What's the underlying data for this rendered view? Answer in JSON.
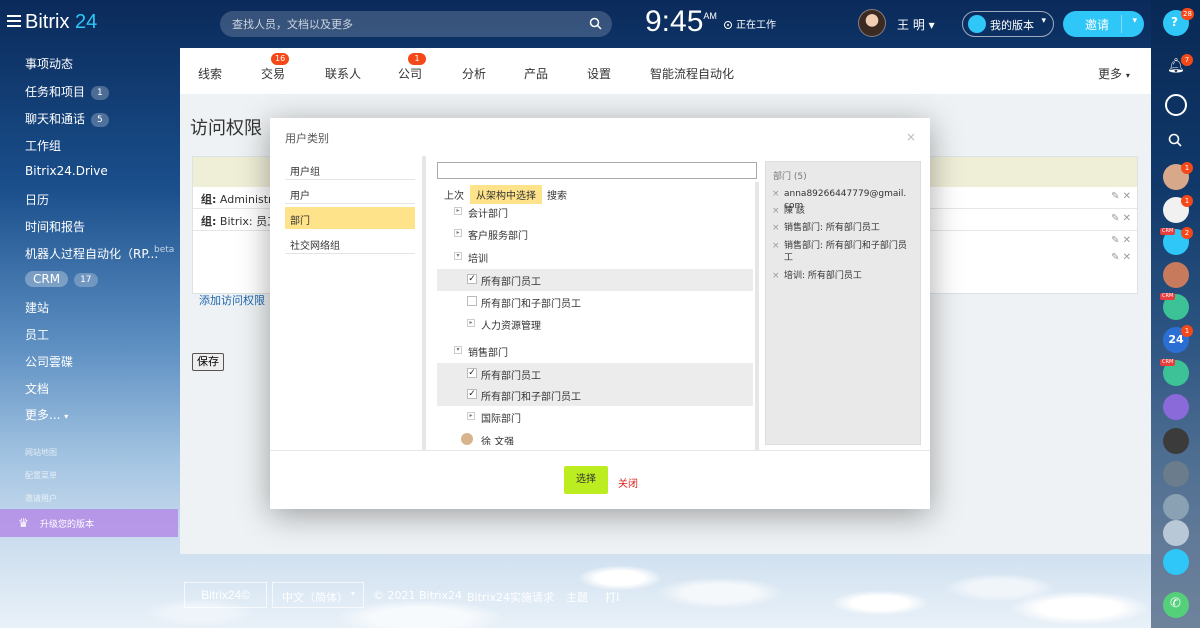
{
  "app": {
    "logo_text": "Bitrix",
    "logo_num": "24"
  },
  "search": {
    "placeholder": "查找人员，文档以及更多"
  },
  "clock": {
    "time": "9:45",
    "ampm": "AM"
  },
  "status": {
    "label": "正在工作"
  },
  "user": {
    "name": "王 明"
  },
  "plan_button": {
    "label": "我的版本"
  },
  "invite_button": {
    "label": "邀请"
  },
  "left_menu": {
    "items": [
      {
        "label": "事项动态"
      },
      {
        "label": "任务和项目",
        "count": "1"
      },
      {
        "label": "聊天和通话",
        "count": "5"
      },
      {
        "label": "工作组"
      },
      {
        "label": "Bitrix24.Drive"
      },
      {
        "label": "日历"
      },
      {
        "label": "时间和报告"
      },
      {
        "label": "机器人过程自动化（RP..."
      },
      {
        "label": "CRM",
        "count": "17"
      },
      {
        "label": "建站"
      },
      {
        "label": "员工"
      },
      {
        "label": "公司雲碟"
      },
      {
        "label": "文档"
      },
      {
        "label": "更多..."
      }
    ],
    "beta": "beta",
    "small_links": [
      "网站地图",
      "配置菜单",
      "邀请用户"
    ],
    "upgrade_label": "升级您的版本"
  },
  "tabs": [
    {
      "label": "线索"
    },
    {
      "label": "交易",
      "badge": "16"
    },
    {
      "label": "联系人"
    },
    {
      "label": "公司",
      "badge": "1"
    },
    {
      "label": "分析"
    },
    {
      "label": "产品"
    },
    {
      "label": "设置"
    },
    {
      "label": "智能流程自动化"
    }
  ],
  "more_tab": "更多",
  "page": {
    "title": "访问权限",
    "rows": [
      {
        "text_bold": "组:",
        "text": " Administrat"
      },
      {
        "text_bold": "组:",
        "text": " Bitrix: 员工"
      }
    ],
    "add_link": "添加访问权限",
    "save_label": "保存"
  },
  "dialog": {
    "title": "用户类别",
    "categories": [
      {
        "label": "用户组"
      },
      {
        "label": "用户"
      },
      {
        "label": "部门",
        "active": true
      },
      {
        "label": "社交网络组"
      }
    ],
    "mid_tabs": [
      "上次",
      "从架构中选择",
      "搜索"
    ],
    "tree": [
      {
        "label": "会计部门",
        "type": "folder",
        "expanded": false
      },
      {
        "label": "客户服务部门",
        "type": "folder",
        "expanded": false
      },
      {
        "label": "培训",
        "type": "folder",
        "expanded": true
      },
      {
        "label": "所有部门员工",
        "type": "check",
        "checked": true
      },
      {
        "label": "所有部门和子部门员工",
        "type": "check",
        "checked": false
      },
      {
        "label": "人力资源管理",
        "type": "folder",
        "expanded": false
      },
      {
        "label": "销售部门",
        "type": "folder",
        "expanded": true
      },
      {
        "label": "所有部门员工",
        "type": "check",
        "checked": true
      },
      {
        "label": "所有部门和子部门员工",
        "type": "check",
        "checked": true
      },
      {
        "label": "国际部门",
        "type": "folder",
        "expanded": false
      },
      {
        "label": "徐 文强",
        "type": "person"
      }
    ],
    "selected_title": "部门 (5)",
    "selected": [
      "anna89266447779@gmail.com",
      "陳 該",
      "销售部门: 所有部门员工",
      "销售部门: 所有部门和子部门员工",
      "培训: 所有部门员工"
    ],
    "select_label": "选择",
    "cancel_label": "关闭"
  },
  "footer": {
    "logo": "Bitrix24©",
    "language": "中文（简体）",
    "copyright": "© 2021 Bitrix24",
    "impl_request": "Bitrix24实施请求",
    "theme": "主题",
    "print": "打印"
  },
  "right_bar": {
    "help_badge": "28",
    "notify_badge": "7",
    "avatar_badges": [
      "1",
      "1",
      "2",
      "1"
    ],
    "crm_tag": "CRM",
    "chat_count_label": "24"
  },
  "colors": {
    "accent": "#2fc7f7",
    "badge": "#f54819",
    "select_button": "#bbed21",
    "cancel_link": "#d9251c",
    "active_item": "#ffe38a"
  }
}
